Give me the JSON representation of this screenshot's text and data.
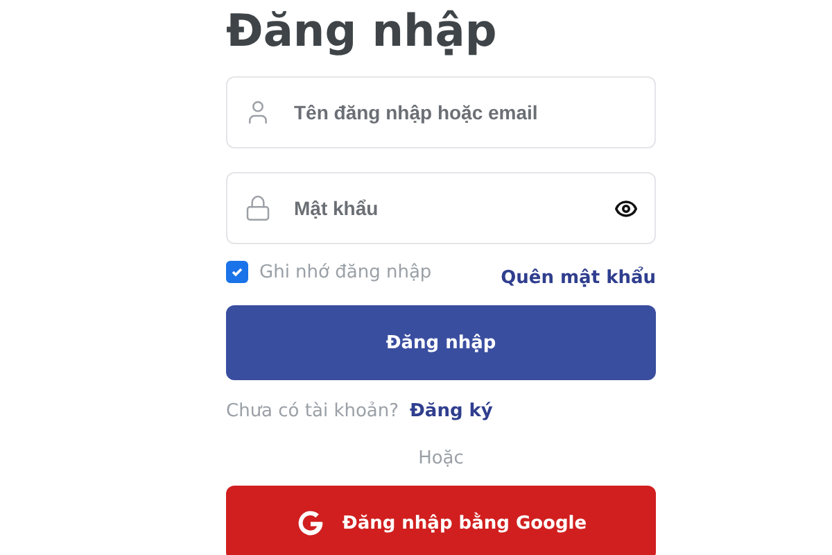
{
  "title": "Đăng nhập",
  "fields": [
    {
      "kind": "user",
      "placeholder": "Tên đăng nhập hoặc email"
    },
    {
      "kind": "password",
      "placeholder": "Mật khẩu"
    }
  ],
  "remember": {
    "label": "Ghi nhớ đăng nhập",
    "checked": true
  },
  "forgot_link": "Quên mật khẩu",
  "submit_button": "Đăng nhập",
  "signup": {
    "prompt": "Chưa có tài khoản?",
    "link": "Đăng ký"
  },
  "divider": "Hoặc",
  "google_button": "Đăng nhập bằng Google"
}
